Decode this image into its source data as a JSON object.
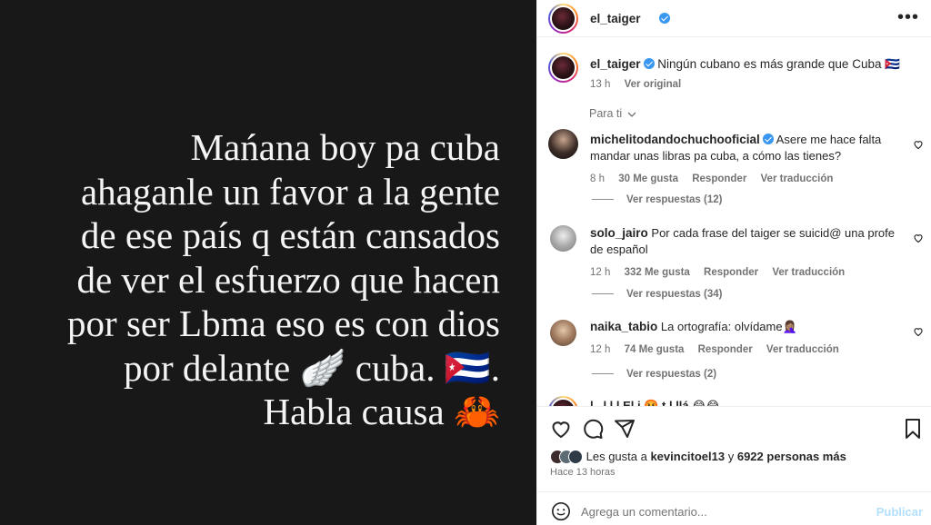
{
  "story": {
    "lines": [
      "Mańana boy pa cuba",
      "ahaganle un favor a la gente",
      "de ese país q están cansados",
      "de ver el esfuerzo que hacen",
      "por ser Lbma eso es con dios",
      "por delante 🪽 cuba. 🇨🇺.",
      "Habla causa 🦀"
    ]
  },
  "header": {
    "username": "el_taiger",
    "more_icon": "more-horizontal-icon"
  },
  "caption": {
    "username": "el_taiger",
    "text": "Ningún cubano es más grande que Cuba 🇨🇺",
    "time": "13 h",
    "see_original": "Ver original"
  },
  "filter": {
    "label": "Para ti"
  },
  "comments": [
    {
      "username": "michelitodandochuchooficial",
      "text": "Asere me hace falta mandar unas libras pa cuba, a cómo las tienes?",
      "time": "8 h",
      "likes": "30 Me gusta",
      "reply": "Responder",
      "translate": "Ver traducción",
      "replies": "Ver respuestas (12)"
    },
    {
      "username": "solo_jairo",
      "text": "Por cada frase del taiger se suicid@ una profe de español",
      "time": "12 h",
      "likes": "332 Me gusta",
      "reply": "Responder",
      "translate": "Ver traducción",
      "replies": "Ver respuestas (34)"
    },
    {
      "username": "naika_tabio",
      "text": "La ortografía: olvídame🤦🏽‍♀️",
      "time": "12 h",
      "likes": "74 Me gusta",
      "reply": "Responder",
      "translate": "Ver traducción",
      "replies": "Ver respuestas (2)"
    }
  ],
  "partial_comment": {
    "text": "l.. l    l  l     El  i  🤬    t   l    llá 😂😂"
  },
  "likes": {
    "prefix": "Les gusta a ",
    "user": "kevincitoel13",
    "mid": " y ",
    "count": "6922 personas más"
  },
  "posted": "Hace 13 horas",
  "comment_box": {
    "placeholder": "Agrega un comentario...",
    "publish": "Publicar"
  }
}
